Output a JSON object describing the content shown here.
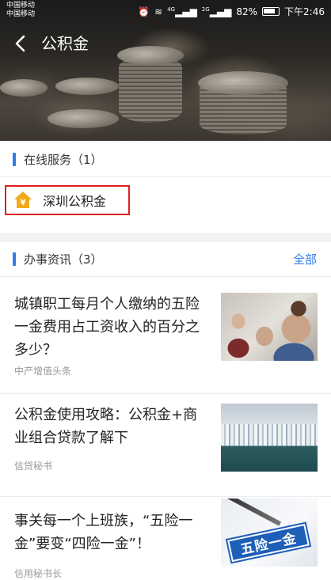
{
  "status_bar": {
    "carrier_1": "中国移动",
    "carrier_2": "中国移动",
    "signal_1": "4G",
    "signal_2": "2G",
    "battery": "82%",
    "time": "下午2:46"
  },
  "header": {
    "title": "公积金"
  },
  "online_services": {
    "title": "在线服务（1）",
    "items": [
      {
        "label": "深圳公积金",
        "icon": "house-yuan-icon"
      }
    ]
  },
  "news": {
    "title": "办事资讯（3）",
    "more_label": "全部",
    "items": [
      {
        "title": "城镇职工每月个人缴纳的五险一金费用占工资收入的百分之多少？",
        "source": "中产增值头条"
      },
      {
        "title": "公积金使用攻略：公积金+商业组合贷款了解下",
        "source": "信贷秘书"
      },
      {
        "title": "事关每一个上班族，“五险一金”要变“四险一金”！",
        "source": "信用秘书长"
      }
    ],
    "thumb3_text": "五险一金"
  }
}
